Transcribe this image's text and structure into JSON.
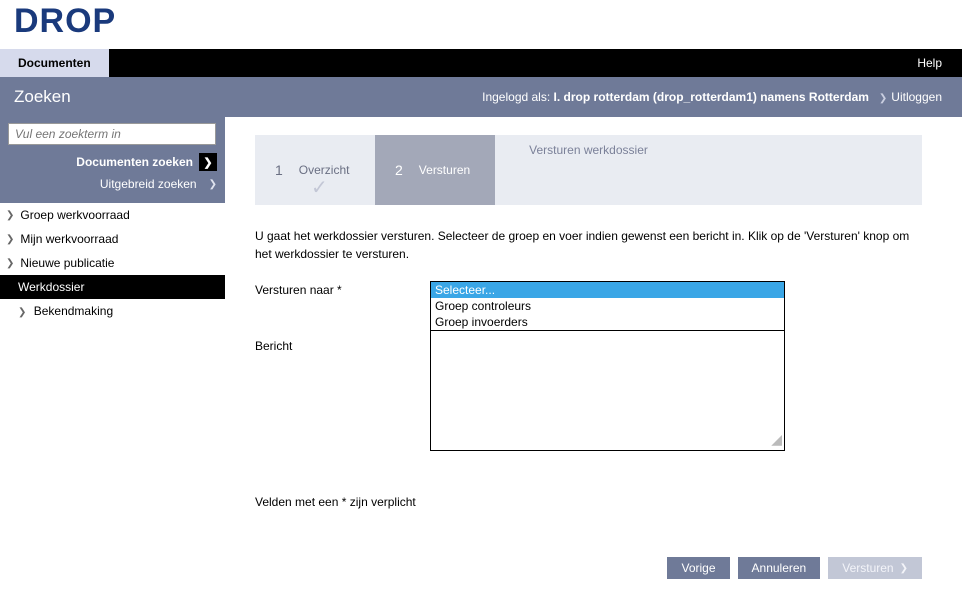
{
  "logo": "DROP",
  "navbar": {
    "tab": "Documenten",
    "help": "Help"
  },
  "subbar": {
    "title": "Zoeken",
    "logged_prefix": "Ingelogd als:",
    "logged_user": "I. drop rotterdam (drop_rotterdam1) namens Rotterdam",
    "logout": "Uitloggen"
  },
  "search": {
    "placeholder": "Vul een zoekterm in",
    "doc_zoeken": "Documenten zoeken",
    "uitgebreid": "Uitgebreid zoeken"
  },
  "sidebar": {
    "items": [
      "Groep werkvoorraad",
      "Mijn werkvoorraad",
      "Nieuwe publicatie"
    ],
    "sub_active": "Werkdossier",
    "sub2": "Bekendmaking"
  },
  "wizard": {
    "title": "Versturen werkdossier",
    "step1_num": "1",
    "step1_label": "Overzicht",
    "step2_num": "2",
    "step2_label": "Versturen"
  },
  "instruct": "U gaat het werkdossier versturen. Selecteer de groep en voer indien gewenst een bericht in. Klik op de 'Versturen' knop om het werkdossier te versturen.",
  "form": {
    "send_to_label": "Versturen naar *",
    "bericht_label": "Bericht",
    "options": [
      "Selecteer...",
      "Groep controleurs",
      "Groep invoerders"
    ],
    "selected_index": 0
  },
  "req_note": "Velden met een * zijn verplicht",
  "buttons": {
    "vorige": "Vorige",
    "annuleren": "Annuleren",
    "versturen": "Versturen"
  }
}
